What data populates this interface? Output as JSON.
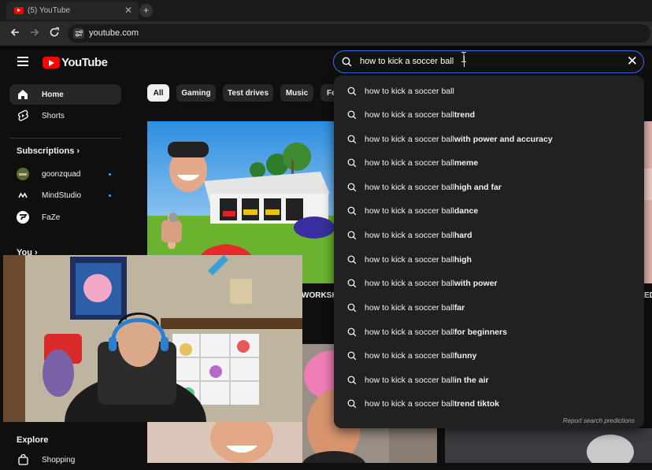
{
  "browser": {
    "tab_title": "(5) YouTube",
    "tab_close": "✕",
    "new_tab": "+",
    "url": "youtube.com"
  },
  "header": {
    "logo_text": "YouTube",
    "search_value": "how to kick a soccer ball",
    "clear_glyph": "✕"
  },
  "sidebar": {
    "items": [
      {
        "label": "Home"
      },
      {
        "label": "Shorts"
      }
    ],
    "subscriptions_title": "Subscriptions",
    "subscriptions": [
      {
        "label": "goonzquad"
      },
      {
        "label": "MindStudio"
      },
      {
        "label": "FaZe"
      }
    ],
    "you_title": "You",
    "explore_title": "Explore",
    "shopping_label": "Shopping"
  },
  "chips": [
    "All",
    "Gaming",
    "Test drives",
    "Music",
    "Fe"
  ],
  "video_title_fragments": {
    "left": "WORKSH",
    "right": "ED"
  },
  "search_dropdown": {
    "typed": "how to kick a soccer ball",
    "suggestions": [
      {
        "rest": ""
      },
      {
        "rest": " trend"
      },
      {
        "rest": " with power and accuracy"
      },
      {
        "rest": " meme"
      },
      {
        "rest": " high and far"
      },
      {
        "rest": " dance"
      },
      {
        "rest": " hard"
      },
      {
        "rest": " high"
      },
      {
        "rest": " with power"
      },
      {
        "rest": " far"
      },
      {
        "rest": " for beginners"
      },
      {
        "rest": " funny"
      },
      {
        "rest": " in the air"
      },
      {
        "rest": " trend tiktok"
      }
    ],
    "report_label": "Report search predictions"
  }
}
